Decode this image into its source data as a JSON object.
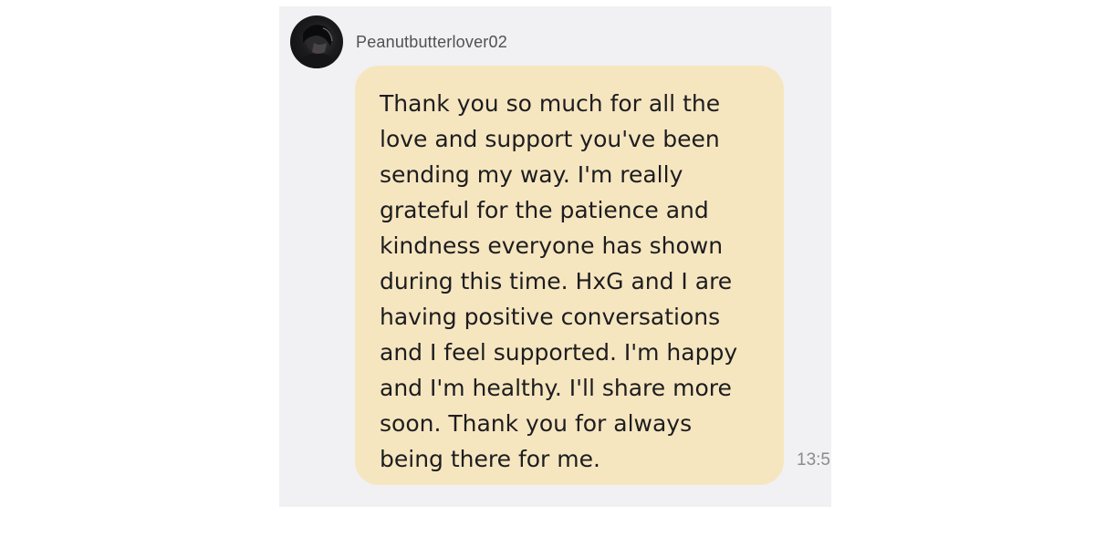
{
  "chat": {
    "sender": {
      "username": "Peanutbutterlover02",
      "avatar_icon": "user-avatar"
    },
    "message": {
      "text": "Thank you so much for all the\nlove and support you've been\nsending my way. I'm really\ngrateful for the patience and\nkindness everyone has shown\nduring this time.  HxG and I are\nhaving positive conversations\nand I feel supported. I'm happy\nand I'm healthy.  I'll share more\nsoon. Thank you for always\nbeing there for me.",
      "timestamp": "13:5",
      "bubble_color": "#f6e6c0"
    },
    "panel_background": "#f1f1f3"
  }
}
